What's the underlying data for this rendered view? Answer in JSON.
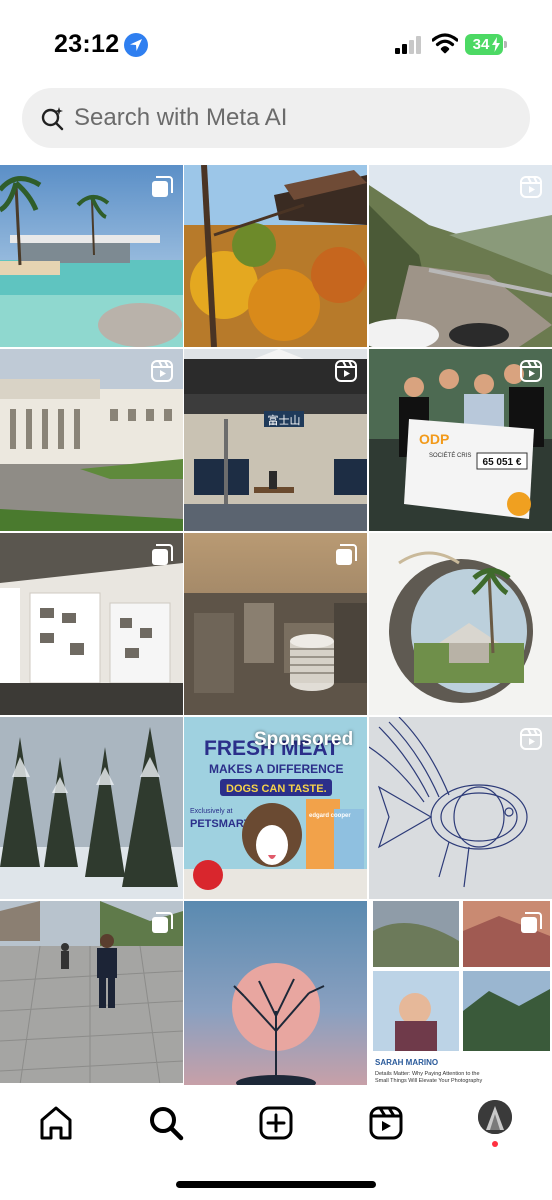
{
  "status_bar": {
    "time": "23:12",
    "battery": "34",
    "icons": [
      "location-arrow-icon",
      "cellular-signal-icon",
      "wifi-icon",
      "battery-charging-icon"
    ],
    "accent_color": "#2f7ff0",
    "battery_color": "#4cd964"
  },
  "search": {
    "placeholder": "Search with Meta AI",
    "icon": "meta-ai-search-icon"
  },
  "grid": {
    "tiles": [
      {
        "subject": "beach-villa",
        "badge": "carousel-icon"
      },
      {
        "subject": "autumn-temple",
        "badge": ""
      },
      {
        "subject": "mountain-road",
        "badge": "reels-icon"
      },
      {
        "subject": "university-building",
        "badge": "reels-icon"
      },
      {
        "subject": "train-station",
        "badge": "reels-icon"
      },
      {
        "subject": "big-check-presentation",
        "badge": "reels-icon"
      },
      {
        "subject": "gallery-room",
        "badge": "carousel-icon"
      },
      {
        "subject": "city-aerial",
        "badge": "carousel-icon"
      },
      {
        "subject": "painted-canteen",
        "badge": ""
      },
      {
        "subject": "snowy-forest",
        "badge": ""
      },
      {
        "subject": "sponsored-ad",
        "badge": "",
        "label": "Sponsored"
      },
      {
        "subject": "wire-fish-sculpture",
        "badge": "reels-icon"
      },
      {
        "subject": "plaza-man",
        "badge": "carousel-icon"
      },
      {
        "subject": "moon-tree",
        "badge": ""
      },
      {
        "subject": "photo-article-collage",
        "badge": "carousel-icon"
      }
    ],
    "ad": {
      "headline_1": "FRESH MEAT",
      "headline_2": "MAKES A DIFFERENCE",
      "headline_3": "DOGS CAN TASTE.",
      "exclusive": "Exclusively at",
      "store": "PETSMART",
      "brand": "edgard cooper"
    },
    "ad_brand_color": "#2b2f8a",
    "collage": {
      "name": "SARAH MARINO",
      "line_1": "Details Matter: Why Paying Attention to the",
      "line_2": "Small Things Will Elevate Your Photography"
    }
  },
  "checkout": {
    "brand": "ODP",
    "amount": "65 051 €",
    "owner": "SOCIÉTÉ CRIS"
  },
  "station_sign": "富士山",
  "bottom_nav": {
    "items": [
      "home-icon",
      "search-icon",
      "create-post-icon",
      "reels-icon",
      "profile-avatar"
    ],
    "notification_color": "#ff3040"
  }
}
